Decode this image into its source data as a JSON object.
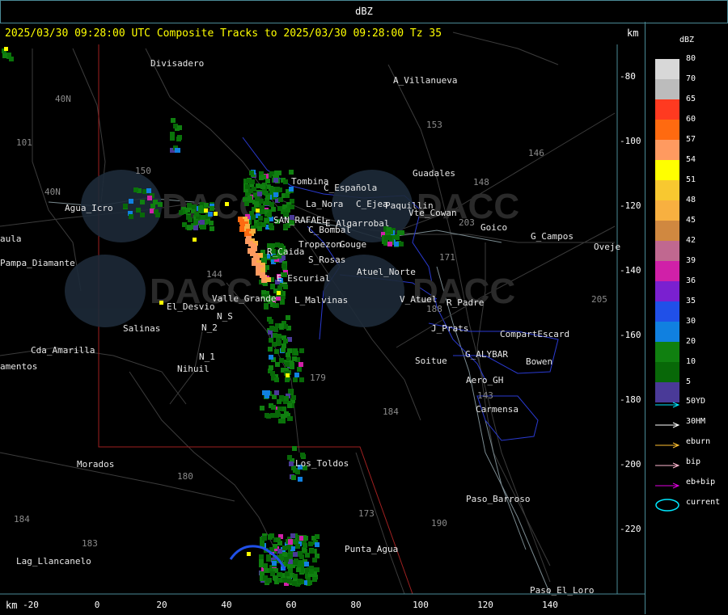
{
  "header": {
    "title": "dBZ"
  },
  "headline": "2025/03/30 09:28:00 UTC Composite Tracks to 2025/03/30 09:28:00 Tz 35",
  "units": {
    "top": "km",
    "bottom": "km"
  },
  "x_ticks": [
    "-20",
    "0",
    "20",
    "40",
    "60",
    "80",
    "100",
    "120",
    "140"
  ],
  "y_ticks": [
    "-80",
    "-100",
    "-120",
    "-140",
    "-160",
    "-180",
    "-200",
    "-220"
  ],
  "legend": {
    "title": "dBZ",
    "levels": [
      {
        "label": "80",
        "color": "#d8d8d8"
      },
      {
        "label": "70",
        "color": "#bcbcbc"
      },
      {
        "label": "65",
        "color": "#ff3a20"
      },
      {
        "label": "60",
        "color": "#ff6a10"
      },
      {
        "label": "57",
        "color": "#ff9a60"
      },
      {
        "label": "54",
        "color": "#ffff00"
      },
      {
        "label": "51",
        "color": "#f8c830"
      },
      {
        "label": "48",
        "color": "#f8b040"
      },
      {
        "label": "45",
        "color": "#d08840"
      },
      {
        "label": "42",
        "color": "#c06890"
      },
      {
        "label": "39",
        "color": "#d020a8"
      },
      {
        "label": "36",
        "color": "#7a20d0"
      },
      {
        "label": "35",
        "color": "#2050e8"
      },
      {
        "label": "30",
        "color": "#1080e0"
      },
      {
        "label": "20",
        "color": "#108010"
      },
      {
        "label": "10",
        "color": "#086808"
      },
      {
        "label": "5",
        "color": "#4a3a98"
      }
    ],
    "tracks": [
      {
        "label": "50YD",
        "color": "#00e8ff"
      },
      {
        "label": "30HM",
        "color": "#ffffff"
      },
      {
        "label": "eburn",
        "color": "#ffc030"
      },
      {
        "label": "bip",
        "color": "#ffb8d0"
      },
      {
        "label": "eb+bip",
        "color": "#e000e0"
      },
      {
        "label": "current",
        "color": "#00e8ff"
      }
    ]
  },
  "places": [
    {
      "name": "Divisadero",
      "color": "light"
    },
    {
      "name": "A_Villanueva",
      "color": "light"
    },
    {
      "name": "Guadales",
      "color": "light"
    },
    {
      "name": "Tombina",
      "color": "light"
    },
    {
      "name": "C_Española",
      "color": "light"
    },
    {
      "name": "C_Ejea",
      "color": "light"
    },
    {
      "name": "La_Nora",
      "color": "light"
    },
    {
      "name": "Paquillin",
      "color": "light"
    },
    {
      "name": "Vte_Cowan",
      "color": "light"
    },
    {
      "name": "SAN_RAFAEL",
      "color": "light"
    },
    {
      "name": "E_Algarrobal",
      "color": "light"
    },
    {
      "name": "C_Bombal",
      "color": "light"
    },
    {
      "name": "Goico",
      "color": "light"
    },
    {
      "name": "G_Campos",
      "color": "light"
    },
    {
      "name": "Agua_Icro",
      "color": "light"
    },
    {
      "name": "aula",
      "color": "light"
    },
    {
      "name": "Pampa_Diamante",
      "color": "light"
    },
    {
      "name": "Tropezon",
      "color": "light"
    },
    {
      "name": "Gouge",
      "color": "light"
    },
    {
      "name": "R_Caida",
      "color": "light"
    },
    {
      "name": "S_Rosas",
      "color": "light"
    },
    {
      "name": "Atuel_Norte",
      "color": "light"
    },
    {
      "name": "E_Escurial",
      "color": "light"
    },
    {
      "name": "L_Malvinas",
      "color": "light"
    },
    {
      "name": "Valle_Grande",
      "color": "light"
    },
    {
      "name": "El_Desvio",
      "color": "light"
    },
    {
      "name": "V_Atuel",
      "color": "light"
    },
    {
      "name": "R_Padre",
      "color": "light"
    },
    {
      "name": "Salinas",
      "color": "light"
    },
    {
      "name": "N_S",
      "color": "light"
    },
    {
      "name": "N_2",
      "color": "light"
    },
    {
      "name": "J_Prats",
      "color": "light"
    },
    {
      "name": "CompartEscard",
      "color": "light"
    },
    {
      "name": "Cda_Amarilla",
      "color": "light"
    },
    {
      "name": "amentos",
      "color": "light"
    },
    {
      "name": "N_1",
      "color": "light"
    },
    {
      "name": "Nihuil",
      "color": "light"
    },
    {
      "name": "G_ALYBAR",
      "color": "light"
    },
    {
      "name": "Soitue",
      "color": "light"
    },
    {
      "name": "Bowen",
      "color": "light"
    },
    {
      "name": "Aero_GH",
      "color": "light"
    },
    {
      "name": "Carmensa",
      "color": "light"
    },
    {
      "name": "Los_Toldos",
      "color": "light"
    },
    {
      "name": "Morados",
      "color": "light"
    },
    {
      "name": "Paso_Barroso",
      "color": "light"
    },
    {
      "name": "Punta_Agua",
      "color": "light"
    },
    {
      "name": "Lag_Llancanelo",
      "color": "light"
    },
    {
      "name": "Paso_El_Loro",
      "color": "light"
    },
    {
      "name": "Oveje",
      "color": "light"
    }
  ],
  "routes": [
    "153",
    "146",
    "40N",
    "101",
    "150",
    "143",
    "148",
    "203",
    "171",
    "144",
    "188",
    "205",
    "179",
    "184",
    "180",
    "183",
    "190",
    "173",
    "40N",
    "184"
  ]
}
